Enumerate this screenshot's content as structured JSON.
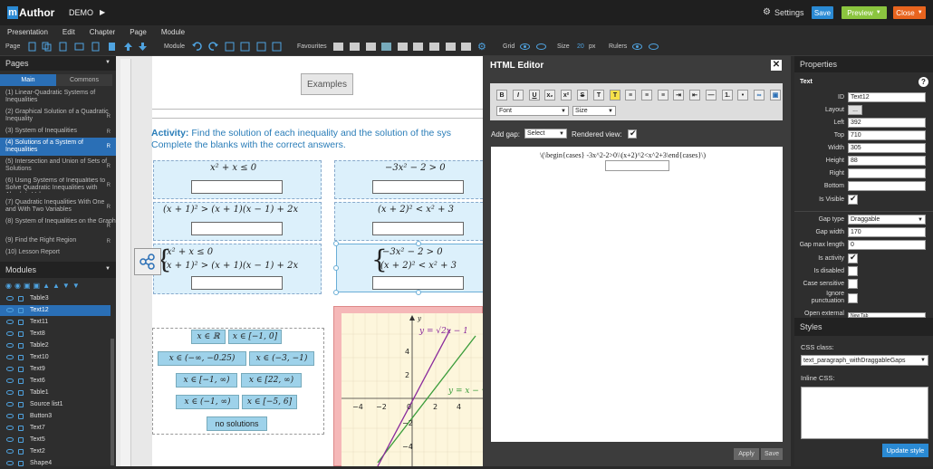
{
  "app": {
    "logo_m": "m",
    "logo_text": "Author",
    "project": "DEMO"
  },
  "top_actions": {
    "settings": "Settings",
    "save": "Save",
    "preview": "Preview",
    "close": "Close"
  },
  "menu": [
    "Presentation",
    "Edit",
    "Chapter",
    "Page",
    "Module"
  ],
  "toolbar": {
    "page": "Page",
    "module": "Module",
    "favourites": "Favourites",
    "grid": "Grid",
    "size": "Size",
    "size_value": "20",
    "size_unit": "px",
    "rulers": "Rulers"
  },
  "pages_panel": {
    "title": "Pages",
    "tab_main": "Main",
    "tab_commons": "Commons",
    "items": [
      {
        "label": "(1) Linear-Quadratic Systems of Inequalities",
        "badge": ""
      },
      {
        "label": "(2) Graphical Solution of a Quadratic Inequality",
        "badge": "R"
      },
      {
        "label": "(3) System of Inequalities",
        "badge": "R"
      },
      {
        "label": "(4) Solutions of a System of Inequalities",
        "badge": "R"
      },
      {
        "label": "(5) Intersection and Union of Sets of Solutions",
        "badge": "R"
      },
      {
        "label": "(6) Using Systems of Inequalities to Solve Quadratic Inequalities with Absolute Values",
        "badge": "R"
      },
      {
        "label": "(7) Quadratic Inequalities With One and With Two Variables",
        "badge": "R"
      },
      {
        "label": "(8) System of Inequalities on the Graph",
        "badge": "R"
      },
      {
        "label": "(9) Find the Right Region",
        "badge": "R"
      },
      {
        "label": "(10) Lesson Report",
        "badge": ""
      }
    ]
  },
  "modules_panel": {
    "title": "Modules",
    "items": [
      "Table3",
      "Text12",
      "Text11",
      "Text8",
      "Table2",
      "Text10",
      "Text9",
      "Text6",
      "Table1",
      "Source list1",
      "Button3",
      "Text7",
      "Text5",
      "Text2",
      "Shape4"
    ]
  },
  "canvas": {
    "examples_button": "Examples",
    "activity_label": "Activity:",
    "activity_text": " Find the solution of each inequality and the solution of the sys",
    "activity_line2": "Complete the blanks with the correct answers.",
    "left_boxes": [
      "x² + x ≤ 0",
      "(x + 1)² > (x + 1)(x − 1) + 2x"
    ],
    "left_system": [
      "x² + x ≤ 0",
      "(x + 1)² > (x + 1)(x − 1) + 2x"
    ],
    "right_boxes": [
      "−3x² − 2 > 0",
      "(x + 2)² < x² + 3"
    ],
    "right_system": [
      "−3x² − 2 > 0",
      "(x + 2)² < x² + 3"
    ],
    "gaps": [
      "x ∈ ℝ",
      "x ∈ [−1, 0]",
      "x ∈ (−∞, −0.25)",
      "x ∈ (−3, −1)",
      "x ∈ [−1, ∞)",
      "x ∈ [22, ∞)",
      "x ∈ (−1, ∞)",
      "x ∈ [−5, 6]",
      "no solutions"
    ],
    "graph": {
      "curve1": "y = √2x − 1",
      "curve2": "y = x − √",
      "y_axis": "y",
      "ticks_x": [
        "−4",
        "−2",
        "0",
        "2",
        "4"
      ],
      "ticks_y": [
        "4",
        "2",
        "−2",
        "−4"
      ]
    }
  },
  "html_editor": {
    "title": "HTML Editor",
    "font_select": "Font",
    "size_select": "Size",
    "add_gap_label": "Add gap:",
    "add_gap_value": "Select",
    "rendered_view_label": "Rendered view:",
    "content": "\\(\\begin{cases} -3x^2-2>0\\\\(x+2)^2<x^2+3\\end{cases}\\)",
    "apply": "Apply",
    "save": "Save"
  },
  "properties": {
    "title": "Properties",
    "section": "Text",
    "fields": [
      {
        "label": "ID",
        "value": "Text12"
      },
      {
        "label": "Layout",
        "value": "..."
      },
      {
        "label": "Left",
        "value": "392"
      },
      {
        "label": "Top",
        "value": "710"
      },
      {
        "label": "Width",
        "value": "305"
      },
      {
        "label": "Height",
        "value": "88"
      },
      {
        "label": "Right",
        "value": ""
      },
      {
        "label": "Bottom",
        "value": ""
      }
    ],
    "is_visible": "Is Visible",
    "gap_type": "Gap type",
    "gap_type_value": "Draggable",
    "gap_width": "Gap width",
    "gap_width_value": "170",
    "gap_max_length": "Gap max length",
    "gap_max_length_value": "0",
    "is_activity": "Is activity",
    "is_disabled": "Is disabled",
    "case_sensitive": "Case sensitive",
    "ignore_punctuation": "Ignore punctuation",
    "open_external": "Open external",
    "open_external_value": "New Tab"
  },
  "styles": {
    "title": "Styles",
    "css_class_label": "CSS class:",
    "css_class_value": "text_paragraph_withDraggableGaps",
    "inline_css_label": "Inline CSS:",
    "update_button": "Update style"
  },
  "colors": {
    "accent_blue": "#2a8ad4",
    "preview_green": "#8bc53f",
    "close_orange": "#e8641e",
    "selected": "#2a6fb6"
  }
}
